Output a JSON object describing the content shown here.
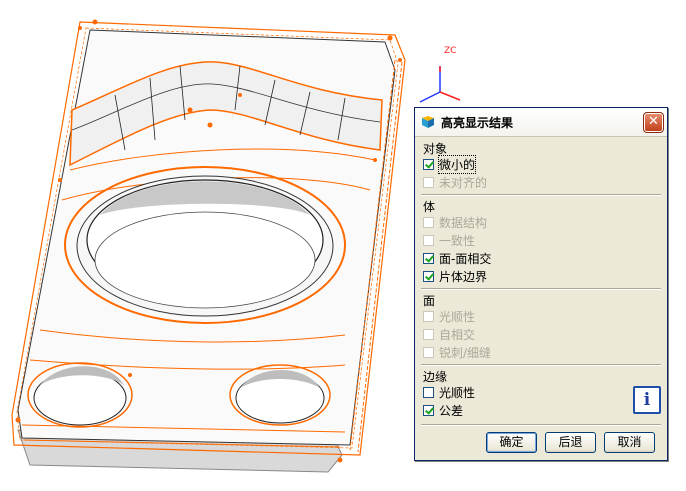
{
  "viewport": {
    "axis_label": "ZC"
  },
  "dialog": {
    "title": "高亮显示结果",
    "close_glyph": "✕",
    "sections": {
      "object": {
        "label": "对象",
        "items": [
          {
            "label": "微小的",
            "checked": true,
            "enabled": true
          },
          {
            "label": "未对齐的",
            "checked": false,
            "enabled": false
          }
        ]
      },
      "body": {
        "label": "体",
        "items": [
          {
            "label": "数据结构",
            "checked": false,
            "enabled": false
          },
          {
            "label": "一致性",
            "checked": false,
            "enabled": false
          },
          {
            "label": "面-面相交",
            "checked": true,
            "enabled": true
          },
          {
            "label": "片体边界",
            "checked": true,
            "enabled": true
          }
        ]
      },
      "face": {
        "label": "面",
        "items": [
          {
            "label": "光顺性",
            "checked": false,
            "enabled": false
          },
          {
            "label": "自相交",
            "checked": false,
            "enabled": false
          },
          {
            "label": "锐刺/细缝",
            "checked": false,
            "enabled": false
          }
        ]
      },
      "edge": {
        "label": "边缘",
        "items": [
          {
            "label": "光顺性",
            "checked": false,
            "enabled": true
          },
          {
            "label": "公差",
            "checked": true,
            "enabled": true
          }
        ]
      }
    },
    "info_glyph": "i",
    "buttons": {
      "ok": "确定",
      "back": "后退",
      "cancel": "取消"
    }
  },
  "colors": {
    "highlight": "#ff6a00",
    "dialog_bg": "#ece9d8",
    "check": "#21a121"
  }
}
